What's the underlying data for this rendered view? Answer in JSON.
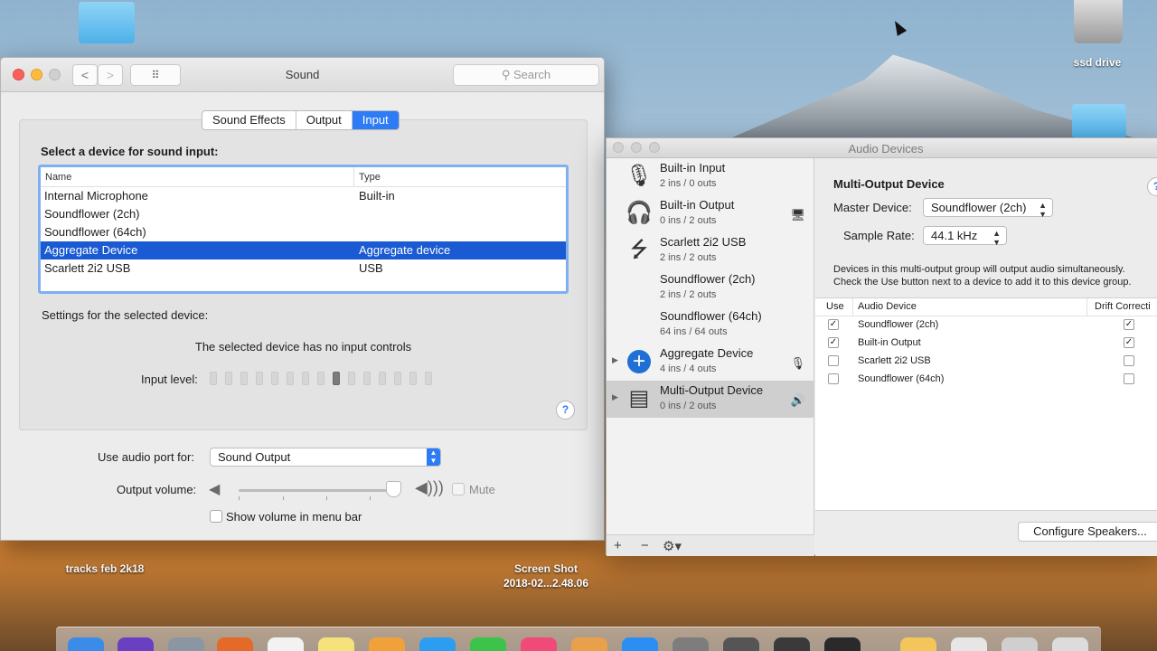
{
  "desktop": {
    "hdd_label": "ssd drive",
    "folder_label": "tracks feb 2k18",
    "screenshot_label_line1": "Screen Shot",
    "screenshot_label_line2": "2018-02...2.48.06"
  },
  "sound_window": {
    "title": "Sound",
    "back_glyph": "<",
    "forward_glyph": ">",
    "grid_glyph": "⠿",
    "search_placeholder": "Search",
    "tabs": [
      {
        "label": "Sound Effects",
        "active": false
      },
      {
        "label": "Output",
        "active": false
      },
      {
        "label": "Input",
        "active": true
      }
    ],
    "select_heading": "Select a device for sound input:",
    "table": {
      "columns": [
        "Name",
        "Type"
      ],
      "rows": [
        {
          "name": "Internal Microphone",
          "type": "Built-in",
          "selected": false
        },
        {
          "name": "Soundflower (2ch)",
          "type": "",
          "selected": false
        },
        {
          "name": "Soundflower (64ch)",
          "type": "",
          "selected": false
        },
        {
          "name": "Aggregate Device",
          "type": "Aggregate device",
          "selected": true
        },
        {
          "name": "Scarlett 2i2 USB",
          "type": "USB",
          "selected": false
        }
      ]
    },
    "settings_label": "Settings for the selected device:",
    "no_controls_text": "The selected device has no input controls",
    "input_level_label": "Input level:",
    "input_level_segments": 15,
    "input_level_active_index": 8,
    "help_glyph": "?",
    "port_label": "Use audio port for:",
    "port_value": "Sound Output",
    "output_volume_label": "Output volume:",
    "output_volume_fraction": 0.95,
    "mute_label": "Mute",
    "mute_checked": false,
    "menubar_label": "Show volume in menu bar",
    "menubar_checked": false
  },
  "audio_devices_window": {
    "title": "Audio Devices",
    "devices": [
      {
        "name": "Built-in Input",
        "io": "2 ins / 0 outs",
        "icon": "microphone-icon",
        "glyph": "🎙",
        "badge": "",
        "disclosure": false,
        "selected": false
      },
      {
        "name": "Built-in Output",
        "io": "0 ins / 2 outs",
        "icon": "headphones-icon",
        "glyph": "🎧",
        "badge": "🖥",
        "disclosure": false,
        "selected": false
      },
      {
        "name": "Scarlett 2i2 USB",
        "io": "2 ins / 2 outs",
        "icon": "usb-icon",
        "glyph": "⭍",
        "badge": "",
        "disclosure": false,
        "selected": false
      },
      {
        "name": "Soundflower (2ch)",
        "io": "2 ins / 2 outs",
        "icon": "",
        "glyph": "",
        "badge": "",
        "disclosure": false,
        "selected": false
      },
      {
        "name": "Soundflower (64ch)",
        "io": "64 ins / 64 outs",
        "icon": "",
        "glyph": "",
        "badge": "",
        "disclosure": false,
        "selected": false
      },
      {
        "name": "Aggregate Device",
        "io": "4 ins / 4 outs",
        "icon": "aggregate-plus-icon",
        "glyph": "+",
        "badge": "🎙",
        "disclosure": true,
        "selected": false
      },
      {
        "name": "Multi-Output Device",
        "io": "0 ins / 2 outs",
        "icon": "multi-output-icon",
        "glyph": "▤",
        "badge": "🔊",
        "disclosure": true,
        "selected": true
      }
    ],
    "toolbar": {
      "add": "+",
      "remove": "−",
      "gear": "⚙▾"
    },
    "detail": {
      "title": "Multi-Output Device",
      "master_label": "Master Device:",
      "master_value": "Soundflower (2ch)",
      "rate_label": "Sample Rate:",
      "rate_value": "44.1 kHz",
      "info_line1": "Devices in this multi-output group will output audio simultaneously.",
      "info_line2": "Check the Use button next to a device to add it to this device group.",
      "help_glyph": "?",
      "columns": [
        "Use",
        "Audio Device",
        "Drift Correcti"
      ],
      "rows": [
        {
          "use": true,
          "device": "Soundflower (2ch)",
          "drift": true
        },
        {
          "use": true,
          "device": "Built-in Output",
          "drift": true
        },
        {
          "use": false,
          "device": "Scarlett 2i2 USB",
          "drift": false
        },
        {
          "use": false,
          "device": "Soundflower (64ch)",
          "drift": false
        }
      ],
      "configure_label": "Configure Speakers..."
    }
  },
  "colors": {
    "accent": "#2d7cf6",
    "selection": "#1a5ad2"
  }
}
